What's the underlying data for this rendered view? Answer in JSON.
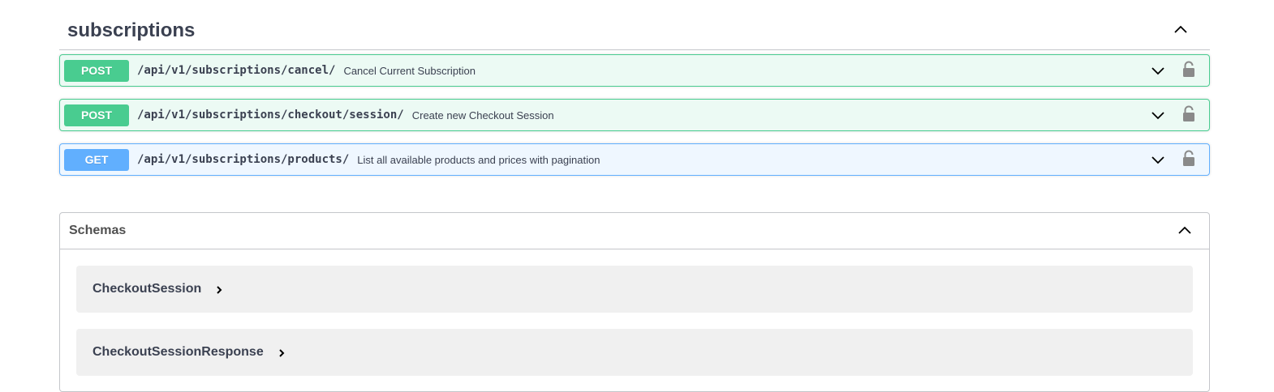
{
  "tag": {
    "title": "subscriptions",
    "toggle_icon": "chevron-up-icon"
  },
  "operations": [
    {
      "method": "POST",
      "path": "/api/v1/subscriptions/cancel/",
      "summary": "Cancel Current Subscription",
      "color": "#49cc90"
    },
    {
      "method": "POST",
      "path": "/api/v1/subscriptions/checkout/session/",
      "summary": "Create new Checkout Session",
      "color": "#49cc90"
    },
    {
      "method": "GET",
      "path": "/api/v1/subscriptions/products/",
      "summary": "List all available products and prices with pagination",
      "color": "#61affe"
    }
  ],
  "schemas": {
    "title": "Schemas",
    "models": [
      {
        "name": "CheckoutSession"
      },
      {
        "name": "CheckoutSessionResponse"
      }
    ]
  },
  "colors": {
    "post": "#49cc90",
    "get": "#61affe",
    "text": "#3b4151",
    "lock": "#8a8a8a"
  }
}
